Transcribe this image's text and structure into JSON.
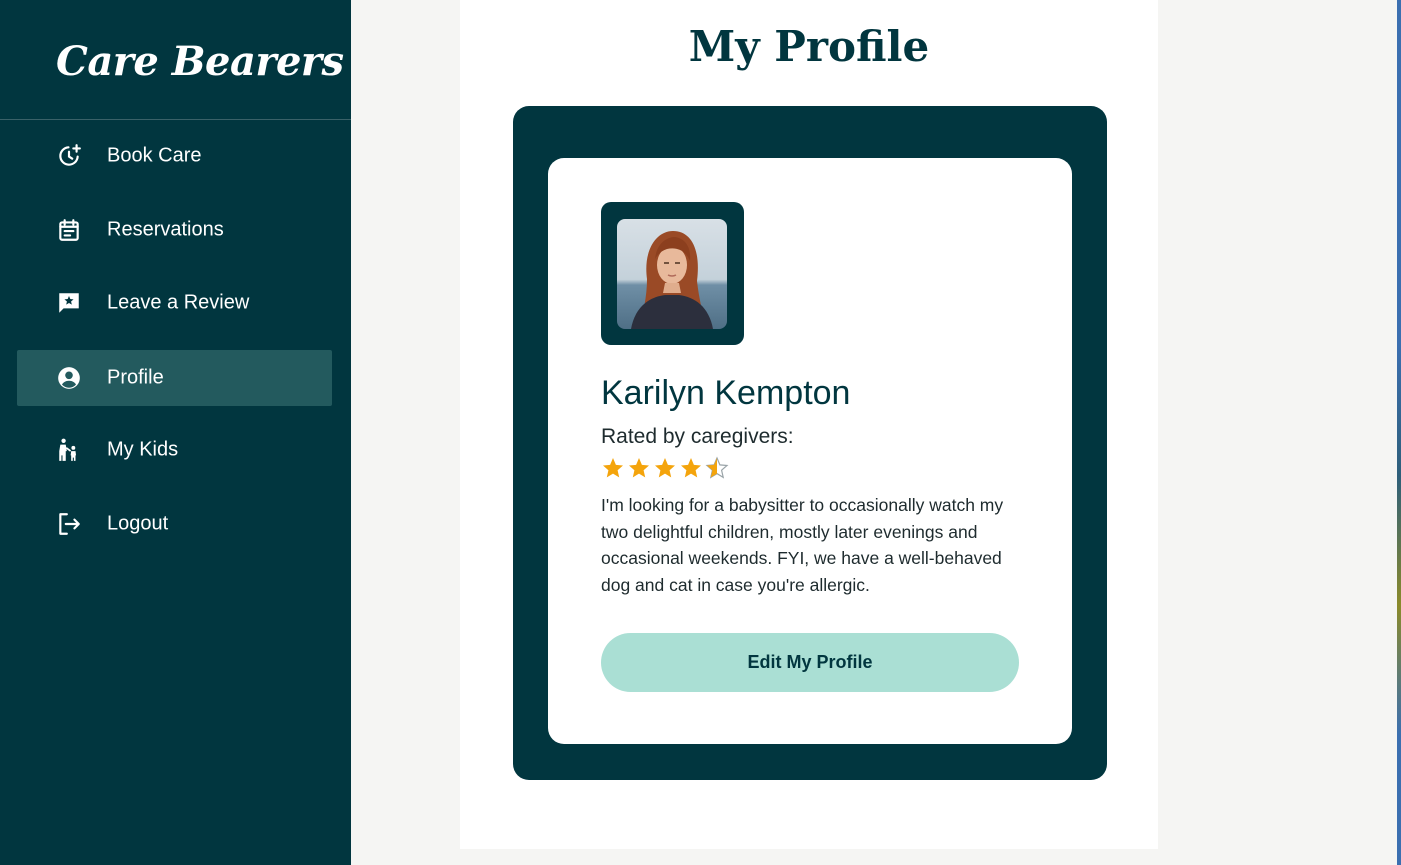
{
  "app": {
    "brand": "Care Bearers"
  },
  "sidebar": {
    "items": [
      {
        "label": "Book Care",
        "icon": "clock-plus-icon",
        "active": false
      },
      {
        "label": "Reservations",
        "icon": "calendar-icon",
        "active": false
      },
      {
        "label": "Leave a Review",
        "icon": "review-chat-icon",
        "active": false
      },
      {
        "label": "Profile",
        "icon": "account-circle-icon",
        "active": true
      },
      {
        "label": "My Kids",
        "icon": "parent-child-icon",
        "active": false
      },
      {
        "label": "Logout",
        "icon": "logout-icon",
        "active": false
      }
    ]
  },
  "main": {
    "title": "My Profile",
    "profile": {
      "name": "Karilyn Kempton",
      "rating_label": "Rated by caregivers:",
      "rating": 4.5,
      "rating_max": 5,
      "bio": "I'm looking for a babysitter to occasionally watch my two delightful children, mostly later evenings and occasional weekends. FYI, we have a well-behaved dog and cat in case you're allergic.",
      "edit_button_label": "Edit My Profile"
    }
  },
  "colors": {
    "sidebar_bg": "#01363f",
    "active_item_bg": "#235a5e",
    "accent_button": "#aadfd4",
    "star": "#f4a40c",
    "page_bg": "#f5f5f3"
  }
}
